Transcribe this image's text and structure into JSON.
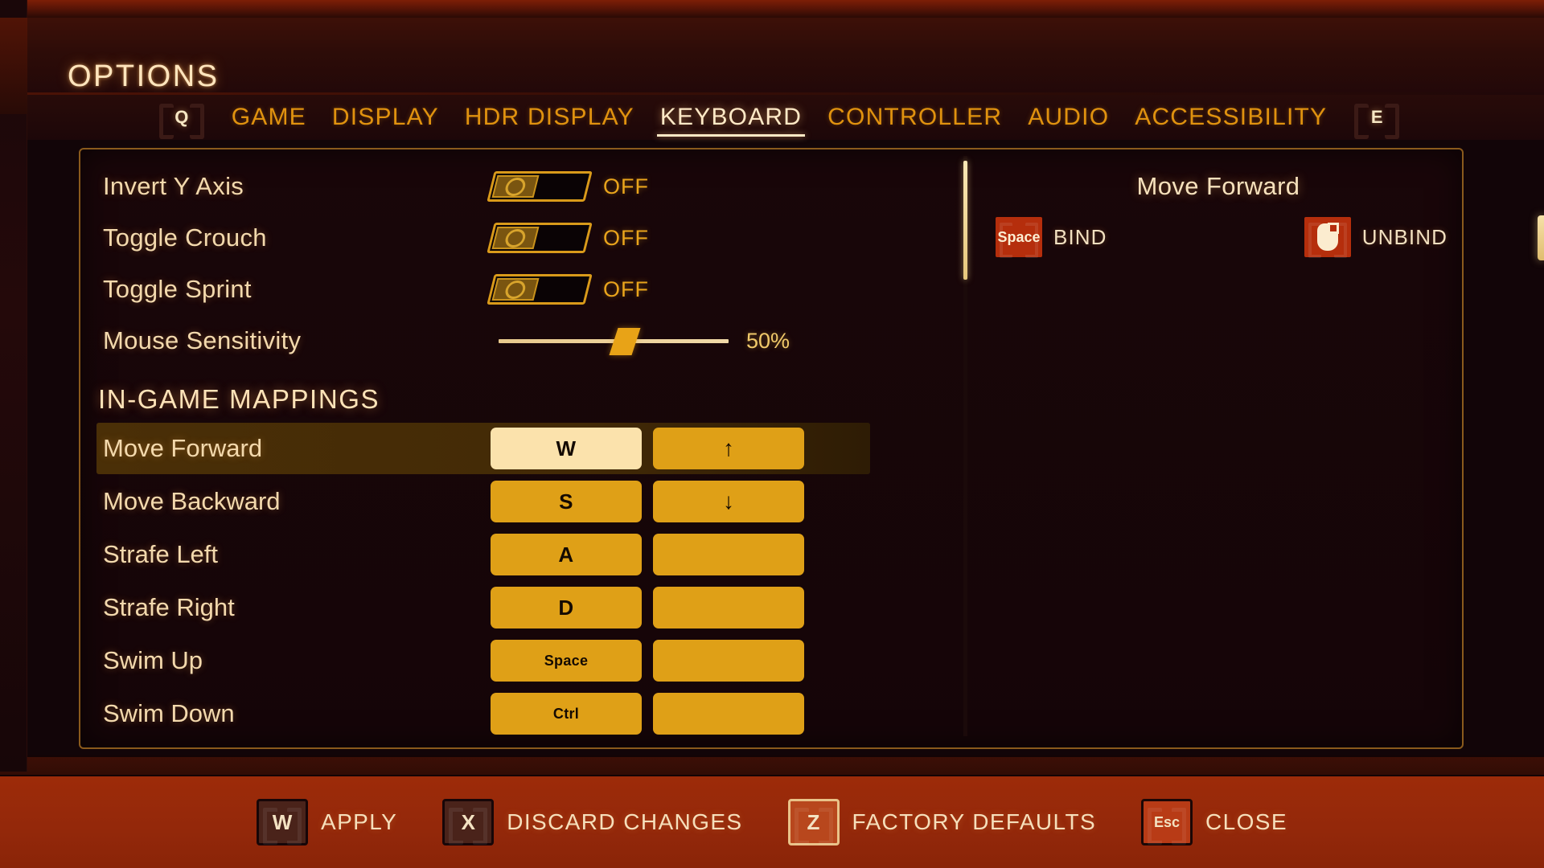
{
  "header": {
    "title": "OPTIONS"
  },
  "tabs": {
    "prev_key": "Q",
    "next_key": "E",
    "items": [
      {
        "label": "GAME",
        "active": false
      },
      {
        "label": "DISPLAY",
        "active": false
      },
      {
        "label": "HDR DISPLAY",
        "active": false
      },
      {
        "label": "KEYBOARD",
        "active": true
      },
      {
        "label": "CONTROLLER",
        "active": false
      },
      {
        "label": "AUDIO",
        "active": false
      },
      {
        "label": "ACCESSIBILITY",
        "active": false
      }
    ]
  },
  "settings": {
    "toggles": [
      {
        "label": "Invert Y Axis",
        "value": "OFF",
        "on": false
      },
      {
        "label": "Toggle Crouch",
        "value": "OFF",
        "on": false
      },
      {
        "label": "Toggle Sprint",
        "value": "OFF",
        "on": false
      }
    ],
    "slider": {
      "label": "Mouse Sensitivity",
      "value": "50%",
      "percent": 50
    }
  },
  "mappings": {
    "section_title": "IN-GAME MAPPINGS",
    "rows": [
      {
        "action": "Move Forward",
        "primary": "W",
        "secondary": "↑",
        "selected": true
      },
      {
        "action": "Move Backward",
        "primary": "S",
        "secondary": "↓",
        "selected": false
      },
      {
        "action": "Strafe Left",
        "primary": "A",
        "secondary": "",
        "selected": false
      },
      {
        "action": "Strafe Right",
        "primary": "D",
        "secondary": "",
        "selected": false
      },
      {
        "action": "Swim Up",
        "primary": "Space",
        "secondary": "",
        "selected": false
      },
      {
        "action": "Swim Down",
        "primary": "Ctrl",
        "secondary": "",
        "selected": false
      }
    ]
  },
  "detail": {
    "title": "Move Forward",
    "bind": {
      "key": "Space",
      "label": "BIND"
    },
    "unbind": {
      "icon": "mouse-icon",
      "label": "UNBIND"
    }
  },
  "bottom_bar": {
    "actions": [
      {
        "key": "W",
        "label": "APPLY",
        "style": "dark"
      },
      {
        "key": "X",
        "label": "DISCARD CHANGES",
        "style": "dark"
      },
      {
        "key": "Z",
        "label": "FACTORY DEFAULTS",
        "style": "light"
      },
      {
        "key": "Esc",
        "label": "CLOSE",
        "style": "red"
      }
    ]
  },
  "colors": {
    "accent_gold": "#dfa017",
    "accent_cream": "#fbe2ac",
    "panel_border": "#8a5a1c",
    "bar_red": "#9d2b09",
    "text_cream": "#f3d9ad"
  }
}
